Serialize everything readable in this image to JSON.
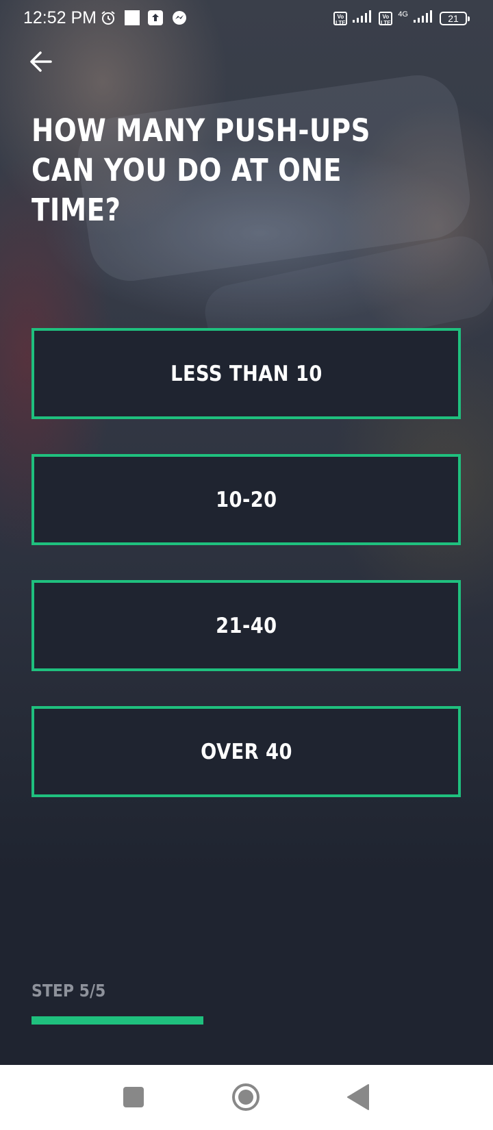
{
  "status_bar": {
    "time": "12:52 PM",
    "battery_level": "21",
    "network_label": "4G",
    "icons": [
      "alarm-icon",
      "notification-square-icon",
      "upload-icon",
      "messenger-icon",
      "volte-icon",
      "signal-icon",
      "volte-icon",
      "signal-4g-icon",
      "battery-icon"
    ]
  },
  "header": {
    "back_icon": "arrow-left-icon"
  },
  "question": {
    "text": "HOW MANY PUSH-UPS CAN YOU DO AT ONE TIME?"
  },
  "options": [
    {
      "label": "LESS THAN 10"
    },
    {
      "label": "10-20"
    },
    {
      "label": "21-40"
    },
    {
      "label": "OVER 40"
    }
  ],
  "progress": {
    "step_label": "STEP 5/5",
    "fraction": 0.4
  },
  "colors": {
    "accent": "#1fc07e",
    "background": "#1f2430",
    "text": "#ffffff",
    "muted": "#8e929b"
  },
  "nav_bar": {
    "icons": [
      "recents-square-icon",
      "home-circle-icon",
      "back-triangle-icon"
    ]
  }
}
